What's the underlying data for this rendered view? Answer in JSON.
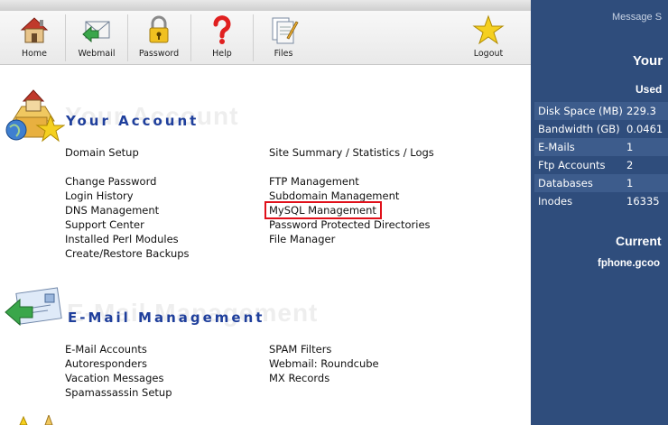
{
  "toolbar": {
    "home": "Home",
    "webmail": "Webmail",
    "password": "Password",
    "help": "Help",
    "files": "Files",
    "logout": "Logout"
  },
  "right_panel": {
    "message_label": "Message S",
    "your_heading": "Your",
    "used_heading": "Used",
    "stats": [
      {
        "label": "Disk Space (MB)",
        "value": "229.3"
      },
      {
        "label": "Bandwidth (GB)",
        "value": "0.0461"
      },
      {
        "label": "E-Mails",
        "value": "1"
      },
      {
        "label": "Ftp Accounts",
        "value": "2"
      },
      {
        "label": "Databases",
        "value": "1"
      },
      {
        "label": "Inodes",
        "value": "16335"
      }
    ],
    "current_heading": "Current",
    "domain": "fphone.gcoo"
  },
  "your_account": {
    "title": "Your Account",
    "ghost": "Your Account",
    "links_left": [
      "Domain Setup",
      "Change Password",
      "Login History",
      "DNS Management",
      "Support Center",
      "Installed Perl Modules",
      "Create/Restore Backups"
    ],
    "links_right": [
      "Site Summary / Statistics / Logs",
      "FTP Management",
      "Subdomain Management",
      "MySQL Management",
      "Password Protected Directories",
      "File Manager"
    ]
  },
  "email_management": {
    "title": "E-Mail Management",
    "ghost": "E-Mail Management",
    "links_left": [
      "E-Mail Accounts",
      "Autoresponders",
      "Vacation Messages",
      "Spamassassin Setup"
    ],
    "links_right": [
      "SPAM Filters",
      "Webmail: Roundcube",
      "MX Records"
    ]
  },
  "colors": {
    "panel": "#2f4d7c",
    "title": "#1f3f9c",
    "highlight": "#e0101a"
  }
}
